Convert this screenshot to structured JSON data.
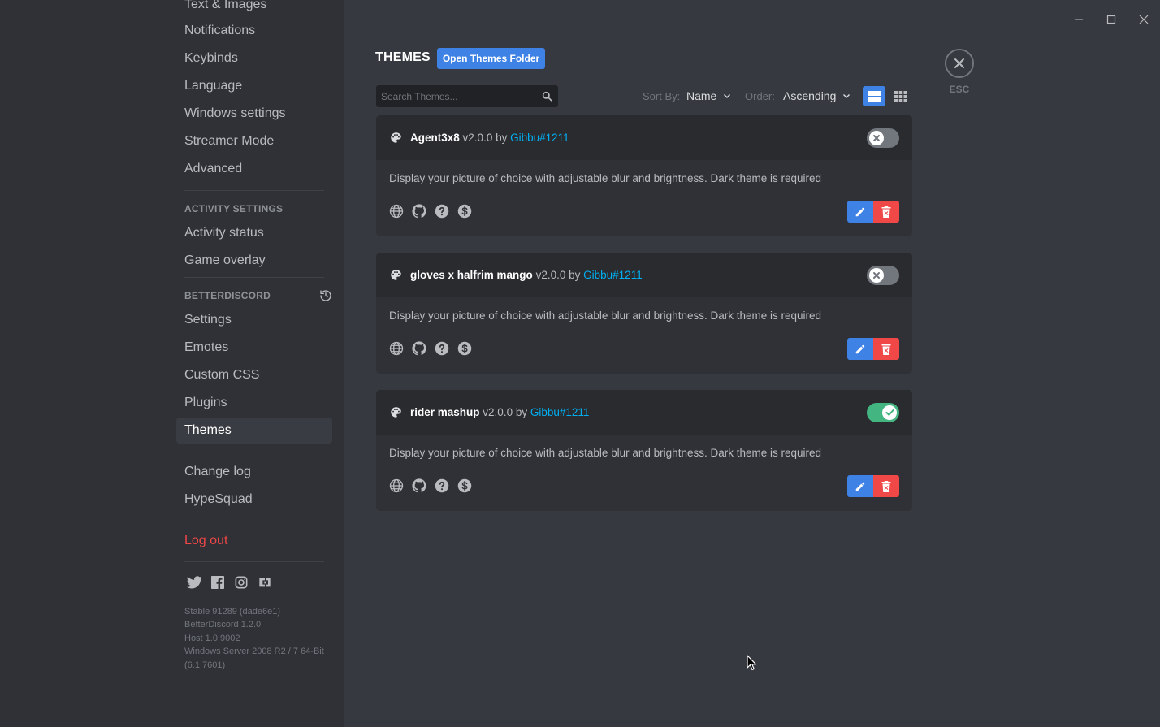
{
  "sidebar": {
    "top_items": [
      {
        "label": "Text & Images"
      },
      {
        "label": "Notifications"
      },
      {
        "label": "Keybinds"
      },
      {
        "label": "Language"
      },
      {
        "label": "Windows settings"
      },
      {
        "label": "Streamer Mode"
      },
      {
        "label": "Advanced"
      }
    ],
    "activity_header": "ACTIVITY SETTINGS",
    "activity_items": [
      {
        "label": "Activity status"
      },
      {
        "label": "Game overlay"
      }
    ],
    "bd_header": "BETTERDISCORD",
    "bd_items": [
      {
        "label": "Settings"
      },
      {
        "label": "Emotes"
      },
      {
        "label": "Custom CSS"
      },
      {
        "label": "Plugins"
      },
      {
        "label": "Themes"
      }
    ],
    "misc_items": [
      {
        "label": "Change log"
      },
      {
        "label": "HypeSquad"
      }
    ],
    "logout_label": "Log out",
    "social_icons": [
      "twitter-icon",
      "facebook-icon",
      "instagram-icon",
      "discord-merch-icon"
    ],
    "version_lines": [
      "Stable 91289 (dade6e1)",
      "BetterDiscord 1.2.0",
      "Host 1.0.9002",
      "Windows Server 2008 R2 / 7 64-Bit (6.1.7601)"
    ]
  },
  "header": {
    "title": "THEMES",
    "open_folder_label": "Open Themes Folder",
    "esc_label": "ESC"
  },
  "controls": {
    "search_placeholder": "Search Themes...",
    "sort_label": "Sort By:",
    "sort_value": "Name",
    "order_label": "Order:",
    "order_value": "Ascending"
  },
  "themes": [
    {
      "name": "Agent3x8",
      "version": "v2.0.0",
      "by": "by",
      "author": "Gibbu#1211",
      "description": "Display your picture of choice with adjustable blur and brightness. Dark theme is required",
      "enabled": false
    },
    {
      "name": "gloves x halfrim mango",
      "version": "v2.0.0",
      "by": "by",
      "author": "Gibbu#1211",
      "description": "Display your picture of choice with adjustable blur and brightness. Dark theme is required",
      "enabled": false
    },
    {
      "name": "rider mashup",
      "version": "v2.0.0",
      "by": "by",
      "author": "Gibbu#1211",
      "description": "Display your picture of choice with adjustable blur and brightness. Dark theme is required",
      "enabled": true
    }
  ],
  "colors": {
    "accent": "#3e82e5",
    "danger": "#f04747",
    "enabled": "#43b581",
    "link": "#00b0f4"
  }
}
